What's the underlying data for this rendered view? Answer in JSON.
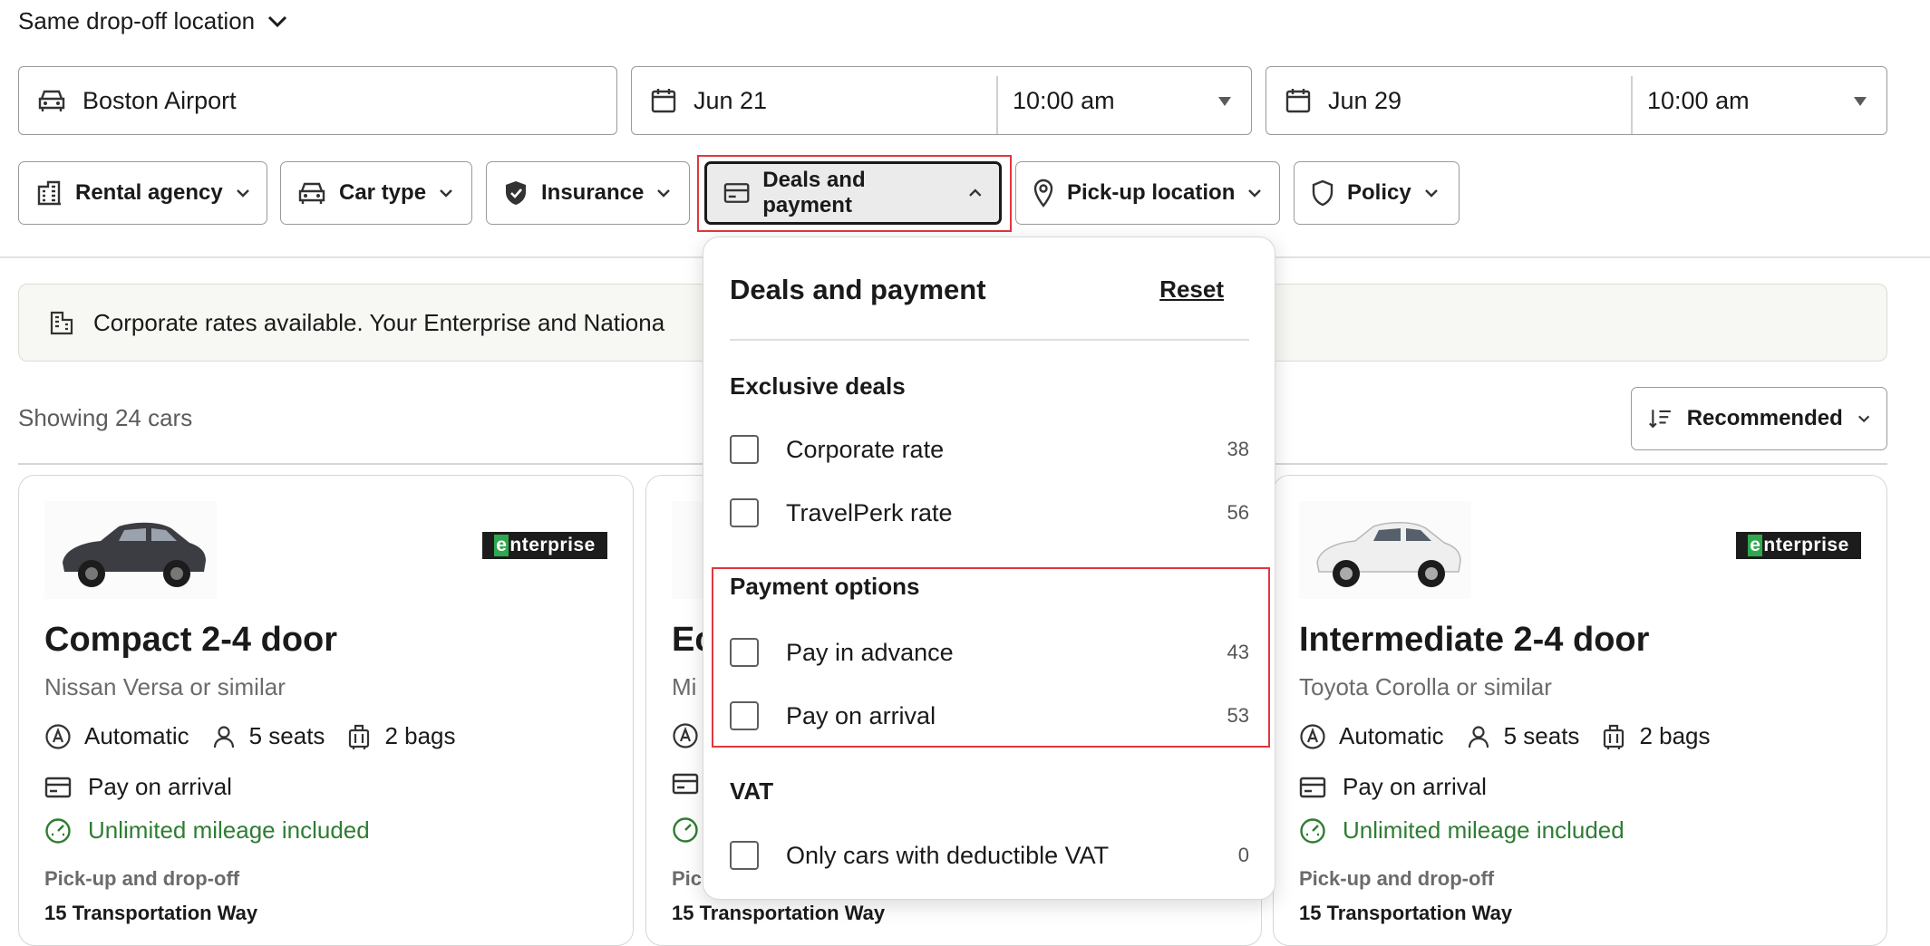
{
  "search": {
    "dropoff_label": "Same drop-off location",
    "location": "Boston Airport",
    "pickup_date": "Jun 21",
    "pickup_time": "10:00 am",
    "dropoff_date": "Jun 29",
    "dropoff_time": "10:00 am"
  },
  "filters": [
    {
      "label": "Rental agency",
      "icon": "building-icon"
    },
    {
      "label": "Car type",
      "icon": "car-icon"
    },
    {
      "label": "Insurance",
      "icon": "shield-check-icon"
    },
    {
      "label": "Deals and payment",
      "icon": "credit-card-icon",
      "active": true
    },
    {
      "label": "Pick-up location",
      "icon": "location-pin-icon"
    },
    {
      "label": "Policy",
      "icon": "shield-icon"
    }
  ],
  "banner": {
    "text": "Corporate rates available. Your Enterprise and Nationa"
  },
  "results": {
    "showing": "Showing 24 cars",
    "sort_label": "Recommended"
  },
  "cards": [
    {
      "title": "Compact 2-4 door",
      "subtitle": "Nissan Versa or similar",
      "transmission": "Automatic",
      "seats": "5 seats",
      "bags": "2 bags",
      "payment": "Pay on arrival",
      "mileage": "Unlimited mileage included",
      "pickup_heading": "Pick-up and drop-off",
      "address": "15 Transportation Way",
      "logo": "enterprise",
      "car_color": "#3b3d42"
    },
    {
      "title": "Ec",
      "subtitle": "Mi",
      "pickup_heading": "Pic",
      "address": "15 Transportation Way"
    },
    {
      "title": "Intermediate 2-4 door",
      "subtitle": "Toyota Corolla or similar",
      "transmission": "Automatic",
      "seats": "5 seats",
      "bags": "2 bags",
      "payment": "Pay on arrival",
      "mileage": "Unlimited mileage included",
      "pickup_heading": "Pick-up and drop-off",
      "address": "15 Transportation Way",
      "logo": "enterprise",
      "car_color": "#f2f2f2"
    }
  ],
  "dropdown": {
    "title": "Deals and payment",
    "reset": "Reset",
    "sections": [
      {
        "title": "Exclusive deals",
        "options": [
          {
            "label": "Corporate rate",
            "count": "38"
          },
          {
            "label": "TravelPerk rate",
            "count": "56"
          }
        ]
      },
      {
        "title": "Payment options",
        "options": [
          {
            "label": "Pay in advance",
            "count": "43"
          },
          {
            "label": "Pay on arrival",
            "count": "53"
          }
        ]
      },
      {
        "title": "VAT",
        "options": [
          {
            "label": "Only cars with deductible VAT",
            "count": "0"
          }
        ]
      }
    ]
  },
  "colors": {
    "highlight": "#e2363f",
    "mileage_green": "#2e7d32",
    "enterprise_green": "#2fa84f"
  }
}
